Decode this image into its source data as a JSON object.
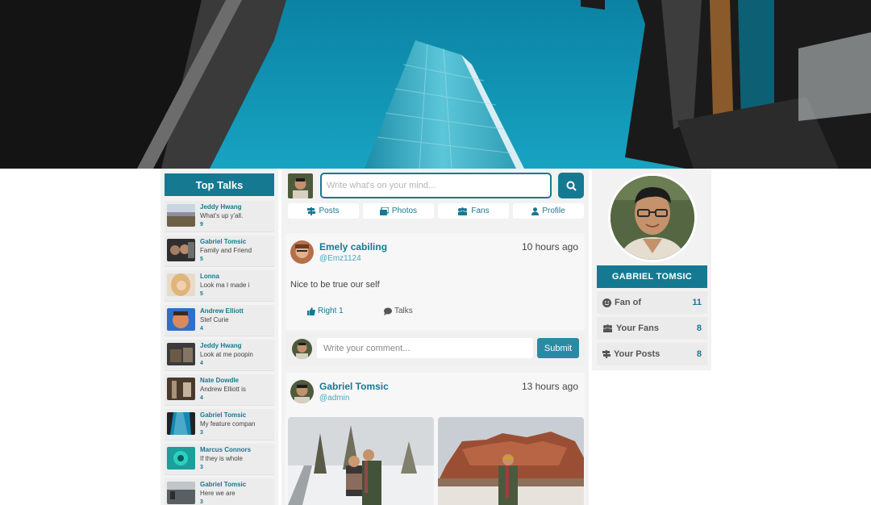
{
  "compose": {
    "placeholder": "Write what's on your mind...",
    "nav": [
      {
        "label": "Posts",
        "icon": "signpost-icon"
      },
      {
        "label": "Photos",
        "icon": "photos-icon"
      },
      {
        "label": "Fans",
        "icon": "users-icon"
      },
      {
        "label": "Profile",
        "icon": "user-icon"
      }
    ]
  },
  "top_talks": {
    "title": "Top Talks",
    "items": [
      {
        "name": "Jeddy Hwang",
        "message": "What's up y'all.",
        "count": "9"
      },
      {
        "name": "Gabriel Tomsic",
        "message": "Family and Friend",
        "count": "5"
      },
      {
        "name": "Lonna",
        "message": "Look ma I made i",
        "count": "5"
      },
      {
        "name": "Andrew Elliott",
        "message": "Stef Curie",
        "count": "4"
      },
      {
        "name": "Jeddy Hwang",
        "message": "Look at me poopin",
        "count": "4"
      },
      {
        "name": "Nate Dowdle",
        "message": "Andrew Elliott is",
        "count": "4"
      },
      {
        "name": "Gabriel Tomsic",
        "message": "My feature compan",
        "count": "3"
      },
      {
        "name": "Marcus Connors",
        "message": "If they is whole",
        "count": "3"
      },
      {
        "name": "Gabriel Tomsic",
        "message": "Here we are",
        "count": "3"
      }
    ]
  },
  "posts": [
    {
      "name": "Emely cabiling",
      "handle": "@Emz1124",
      "time": "10 hours ago",
      "text": "Nice to be true our self",
      "like_label": "Right 1",
      "talks_label": "Talks",
      "comment_placeholder": "Write your comment...",
      "submit_label": "Submit"
    },
    {
      "name": "Gabriel Tomsic",
      "handle": "@admin",
      "time": "13 hours ago"
    }
  ],
  "profile": {
    "name": "GABRIEL TOMSIC",
    "stats": [
      {
        "label": "Fan of",
        "value": "11",
        "icon": "smile-icon"
      },
      {
        "label": "Your Fans",
        "value": "8",
        "icon": "users-icon"
      },
      {
        "label": "Your Posts",
        "value": "8",
        "icon": "signpost-icon"
      }
    ]
  },
  "colors": {
    "accent": "#167992",
    "sky": "#0e8fae"
  }
}
